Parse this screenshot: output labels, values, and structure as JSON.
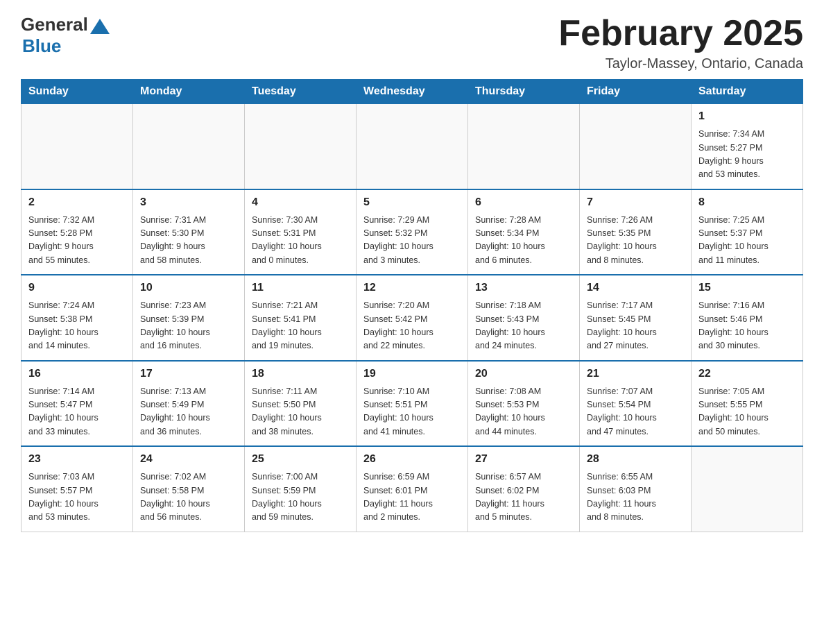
{
  "header": {
    "logo_general": "General",
    "logo_blue": "Blue",
    "month_title": "February 2025",
    "location": "Taylor-Massey, Ontario, Canada"
  },
  "weekdays": [
    "Sunday",
    "Monday",
    "Tuesday",
    "Wednesday",
    "Thursday",
    "Friday",
    "Saturday"
  ],
  "weeks": [
    [
      {
        "day": "",
        "info": ""
      },
      {
        "day": "",
        "info": ""
      },
      {
        "day": "",
        "info": ""
      },
      {
        "day": "",
        "info": ""
      },
      {
        "day": "",
        "info": ""
      },
      {
        "day": "",
        "info": ""
      },
      {
        "day": "1",
        "info": "Sunrise: 7:34 AM\nSunset: 5:27 PM\nDaylight: 9 hours\nand 53 minutes."
      }
    ],
    [
      {
        "day": "2",
        "info": "Sunrise: 7:32 AM\nSunset: 5:28 PM\nDaylight: 9 hours\nand 55 minutes."
      },
      {
        "day": "3",
        "info": "Sunrise: 7:31 AM\nSunset: 5:30 PM\nDaylight: 9 hours\nand 58 minutes."
      },
      {
        "day": "4",
        "info": "Sunrise: 7:30 AM\nSunset: 5:31 PM\nDaylight: 10 hours\nand 0 minutes."
      },
      {
        "day": "5",
        "info": "Sunrise: 7:29 AM\nSunset: 5:32 PM\nDaylight: 10 hours\nand 3 minutes."
      },
      {
        "day": "6",
        "info": "Sunrise: 7:28 AM\nSunset: 5:34 PM\nDaylight: 10 hours\nand 6 minutes."
      },
      {
        "day": "7",
        "info": "Sunrise: 7:26 AM\nSunset: 5:35 PM\nDaylight: 10 hours\nand 8 minutes."
      },
      {
        "day": "8",
        "info": "Sunrise: 7:25 AM\nSunset: 5:37 PM\nDaylight: 10 hours\nand 11 minutes."
      }
    ],
    [
      {
        "day": "9",
        "info": "Sunrise: 7:24 AM\nSunset: 5:38 PM\nDaylight: 10 hours\nand 14 minutes."
      },
      {
        "day": "10",
        "info": "Sunrise: 7:23 AM\nSunset: 5:39 PM\nDaylight: 10 hours\nand 16 minutes."
      },
      {
        "day": "11",
        "info": "Sunrise: 7:21 AM\nSunset: 5:41 PM\nDaylight: 10 hours\nand 19 minutes."
      },
      {
        "day": "12",
        "info": "Sunrise: 7:20 AM\nSunset: 5:42 PM\nDaylight: 10 hours\nand 22 minutes."
      },
      {
        "day": "13",
        "info": "Sunrise: 7:18 AM\nSunset: 5:43 PM\nDaylight: 10 hours\nand 24 minutes."
      },
      {
        "day": "14",
        "info": "Sunrise: 7:17 AM\nSunset: 5:45 PM\nDaylight: 10 hours\nand 27 minutes."
      },
      {
        "day": "15",
        "info": "Sunrise: 7:16 AM\nSunset: 5:46 PM\nDaylight: 10 hours\nand 30 minutes."
      }
    ],
    [
      {
        "day": "16",
        "info": "Sunrise: 7:14 AM\nSunset: 5:47 PM\nDaylight: 10 hours\nand 33 minutes."
      },
      {
        "day": "17",
        "info": "Sunrise: 7:13 AM\nSunset: 5:49 PM\nDaylight: 10 hours\nand 36 minutes."
      },
      {
        "day": "18",
        "info": "Sunrise: 7:11 AM\nSunset: 5:50 PM\nDaylight: 10 hours\nand 38 minutes."
      },
      {
        "day": "19",
        "info": "Sunrise: 7:10 AM\nSunset: 5:51 PM\nDaylight: 10 hours\nand 41 minutes."
      },
      {
        "day": "20",
        "info": "Sunrise: 7:08 AM\nSunset: 5:53 PM\nDaylight: 10 hours\nand 44 minutes."
      },
      {
        "day": "21",
        "info": "Sunrise: 7:07 AM\nSunset: 5:54 PM\nDaylight: 10 hours\nand 47 minutes."
      },
      {
        "day": "22",
        "info": "Sunrise: 7:05 AM\nSunset: 5:55 PM\nDaylight: 10 hours\nand 50 minutes."
      }
    ],
    [
      {
        "day": "23",
        "info": "Sunrise: 7:03 AM\nSunset: 5:57 PM\nDaylight: 10 hours\nand 53 minutes."
      },
      {
        "day": "24",
        "info": "Sunrise: 7:02 AM\nSunset: 5:58 PM\nDaylight: 10 hours\nand 56 minutes."
      },
      {
        "day": "25",
        "info": "Sunrise: 7:00 AM\nSunset: 5:59 PM\nDaylight: 10 hours\nand 59 minutes."
      },
      {
        "day": "26",
        "info": "Sunrise: 6:59 AM\nSunset: 6:01 PM\nDaylight: 11 hours\nand 2 minutes."
      },
      {
        "day": "27",
        "info": "Sunrise: 6:57 AM\nSunset: 6:02 PM\nDaylight: 11 hours\nand 5 minutes."
      },
      {
        "day": "28",
        "info": "Sunrise: 6:55 AM\nSunset: 6:03 PM\nDaylight: 11 hours\nand 8 minutes."
      },
      {
        "day": "",
        "info": ""
      }
    ]
  ]
}
